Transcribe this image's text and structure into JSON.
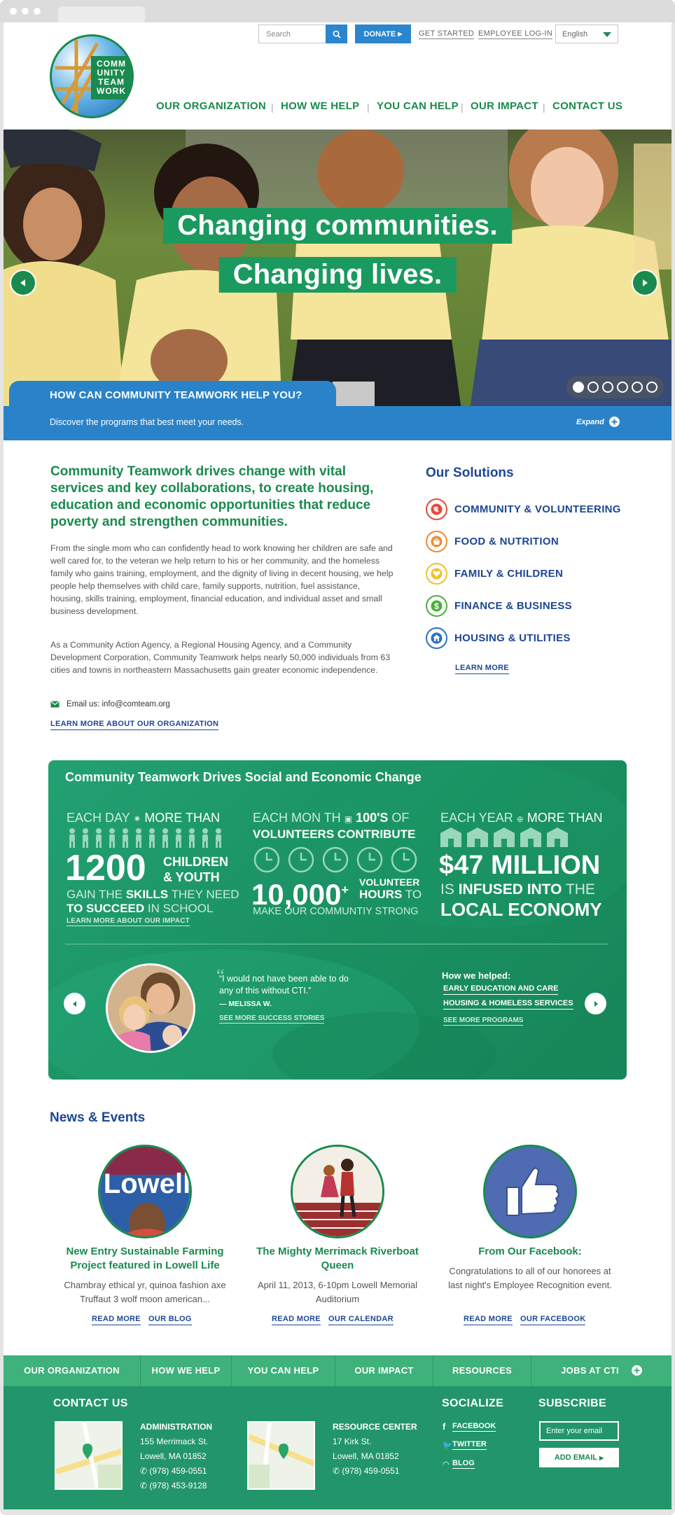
{
  "header": {
    "search_placeholder": "Search",
    "donate": "DONATE",
    "get_started": "GET STARTED",
    "employee_login": "EMPLOYEE LOG-IN",
    "language": "English",
    "logo_text": [
      "COMM",
      "UNITY",
      "TEAM",
      "WORK"
    ],
    "nav": [
      "OUR ORGANIZATION",
      "HOW WE HELP",
      "YOU CAN HELP",
      "OUR IMPACT",
      "CONTACT US"
    ]
  },
  "hero": {
    "line1": "Changing communities.",
    "line2": "Changing lives.",
    "help_title": "HOW CAN COMMUNITY TEAMWORK HELP YOU?",
    "help_sub": "Discover the programs that best meet your needs.",
    "expand": "Expand"
  },
  "intro": {
    "lead": "Community Teamwork drives change with vital services and key collaborations, to create housing, education and economic opportunities that reduce poverty and strengthen communities.",
    "p1": "From the single mom who can confidently head to work knowing her children are safe and well cared for, to the veteran we help return to his or her community, and the homeless family who gains training, employment, and the dignity of living in decent housing, we help people help themselves with child care, family supports, nutrition, fuel assistance, housing, skills training, employment, financial education, and individual asset and small business development.",
    "p2": "As a Community Action Agency, a Regional Housing Agency, and a Community Development Corporation, Community Teamwork helps nearly 50,000 individuals from 63 cities and towns in northeastern Massachusetts gain greater economic independence.",
    "email": "Email us: info@comteam.org",
    "learn_more": "LEARN MORE ABOUT OUR ORGANIZATION"
  },
  "solutions": {
    "title": "Our Solutions",
    "items": [
      {
        "label": "COMMUNITY & VOLUNTEERING",
        "color": "#e24b3b"
      },
      {
        "label": "FOOD & NUTRITION",
        "color": "#f08a2c"
      },
      {
        "label": "FAMILY & CHILDREN",
        "color": "#f2c02c"
      },
      {
        "label": "FINANCE & BUSINESS",
        "color": "#4cae3e"
      },
      {
        "label": "HOUSING & UTILITIES",
        "color": "#2a73c4"
      }
    ],
    "learn_more": "LEARN MORE"
  },
  "impact": {
    "title": "Community Teamwork Drives Social and Economic Change",
    "s1_a": "EACH DAY",
    "s1_b": "MORE THAN",
    "s1_num": "1200",
    "s1_c": "CHILDREN",
    "s1_d": "& YOUTH",
    "s1_e1": "GAIN THE ",
    "s1_e2": "SKILLS",
    "s1_e3": " THEY NEED",
    "s1_f1": "TO SUCCEED",
    "s1_f2": " IN SCHOOL",
    "s1_link": "LEARN MORE ABOUT OUR IMPACT",
    "s2_a": "EACH MON TH",
    "s2_b": "100'S",
    "s2_b2": " OF",
    "s2_c": "VOLUNTEERS CONTRIBUTE",
    "s2_num": "10,000",
    "s2_plus": "+",
    "s2_d": "VOLUNTEER",
    "s2_e1": "HOURS",
    "s2_e2": " TO",
    "s2_f": "MAKE OUR COMMUNTIY STRONG",
    "s3_a": "EACH YEAR",
    "s3_b": "MORE THAN",
    "s3_num": "$47 MILLION",
    "s3_c1": "IS ",
    "s3_c2": "INFUSED INTO",
    "s3_c3": " THE",
    "s3_d": "LOCAL ECONOMY",
    "quote": "“I would not have been able to do any of this without CTI.”",
    "author": "— MELISSA W.",
    "see_stories": "SEE MORE SUCCESS STORIES",
    "how_helped": "How we helped:",
    "helped_links": [
      "EARLY EDUCATION AND CARE",
      "HOUSING & HOMELESS SERVICES"
    ],
    "see_programs": "SEE MORE PROGRAMS"
  },
  "news": {
    "title": "News & Events",
    "items": [
      {
        "title": "New Entry Sustainable Farming Project featured in Lowell Life",
        "text": "Chambray ethical yr, quinoa fashion axe Truffaut 3 wolf moon american...",
        "l1": "READ MORE",
        "l2": "OUR BLOG",
        "img_text": "Lowell"
      },
      {
        "title": "The Mighty Merrimack Riverboat Queen",
        "text": "April 11, 2013, 6-10pm Lowell Memorial Auditorium",
        "l1": "READ MORE",
        "l2": "OUR CALENDAR"
      },
      {
        "title": "From Our Facebook:",
        "text": "Congratulations to all of our honorees at last night's Employee Recognition event.",
        "l1": "READ MORE",
        "l2": "OUR FACEBOOK"
      }
    ]
  },
  "footer": {
    "nav": [
      "OUR ORGANIZATION",
      "HOW WE HELP",
      "YOU CAN HELP",
      "OUR IMPACT",
      "RESOURCES",
      "JOBS AT CTI"
    ],
    "contact_title": "CONTACT US",
    "admin": {
      "name": "ADMINISTRATION",
      "street": "155 Merrimack St.",
      "city": "Lowell, MA 01852",
      "phone1": "(978) 459-0551",
      "phone2": "(978) 453-9128"
    },
    "resource": {
      "name": "RESOURCE CENTER",
      "street": "17 Kirk St.",
      "city": "Lowell, MA 01852",
      "phone1": "(978) 459-0551"
    },
    "socialize_title": "SOCIALIZE",
    "social": [
      "FACEBOOK",
      "TWITTER",
      "BLOG"
    ],
    "subscribe_title": "SUBSCRIBE",
    "email_placeholder": "Enter your email",
    "add_email": "ADD EMAIL"
  }
}
